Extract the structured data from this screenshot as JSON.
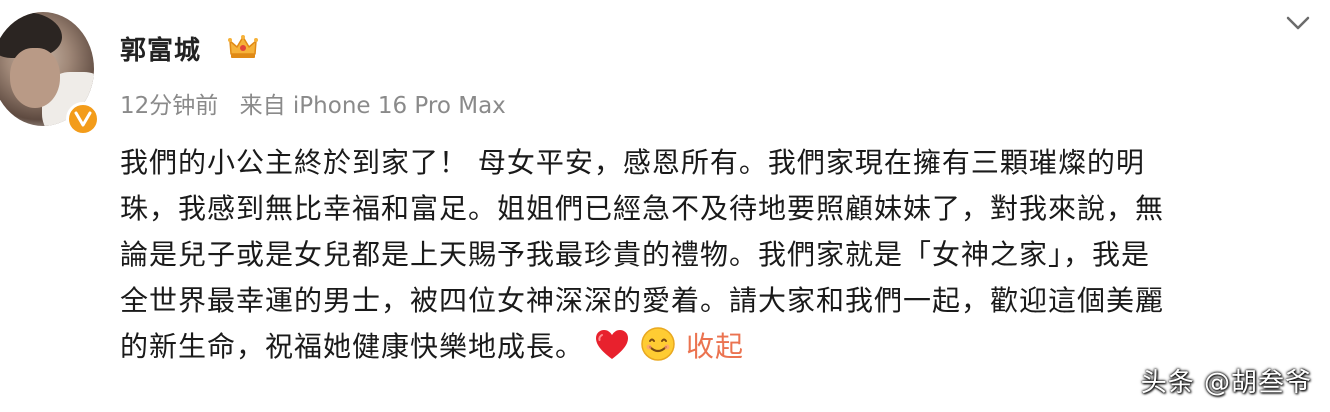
{
  "post": {
    "username": "郭富城",
    "time": "12分钟前",
    "source": "来自 iPhone 16 Pro Max",
    "lines": [
      "我們的小公主終於到家了！ 母女平安，感恩所有。我們家現在擁有三顆璀燦的明",
      "珠，我感到無比幸福和富足。姐姐們已經急不及待地要照顧妹妹了，對我來說，無",
      "論是兒子或是女兒都是上天賜予我最珍貴的禮物。我們家就是「女神之家」，我是",
      "全世界最幸運的男士，被四位女神深深的愛着。請大家和我們一起，歡迎這個美麗",
      "的新生命，祝福她健康快樂地成長。"
    ],
    "collapse_label": "收起"
  },
  "icons": {
    "badge": "crown-icon",
    "verified": "verified-v-icon",
    "menu": "chevron-down-icon",
    "emoji_1": "red-heart-icon",
    "emoji_2": "smile-icon"
  },
  "colors": {
    "accent": "#eb7350",
    "meta": "#8a8a8a",
    "verified": "#f39c1a"
  },
  "watermark": "头条 @胡叁爷"
}
